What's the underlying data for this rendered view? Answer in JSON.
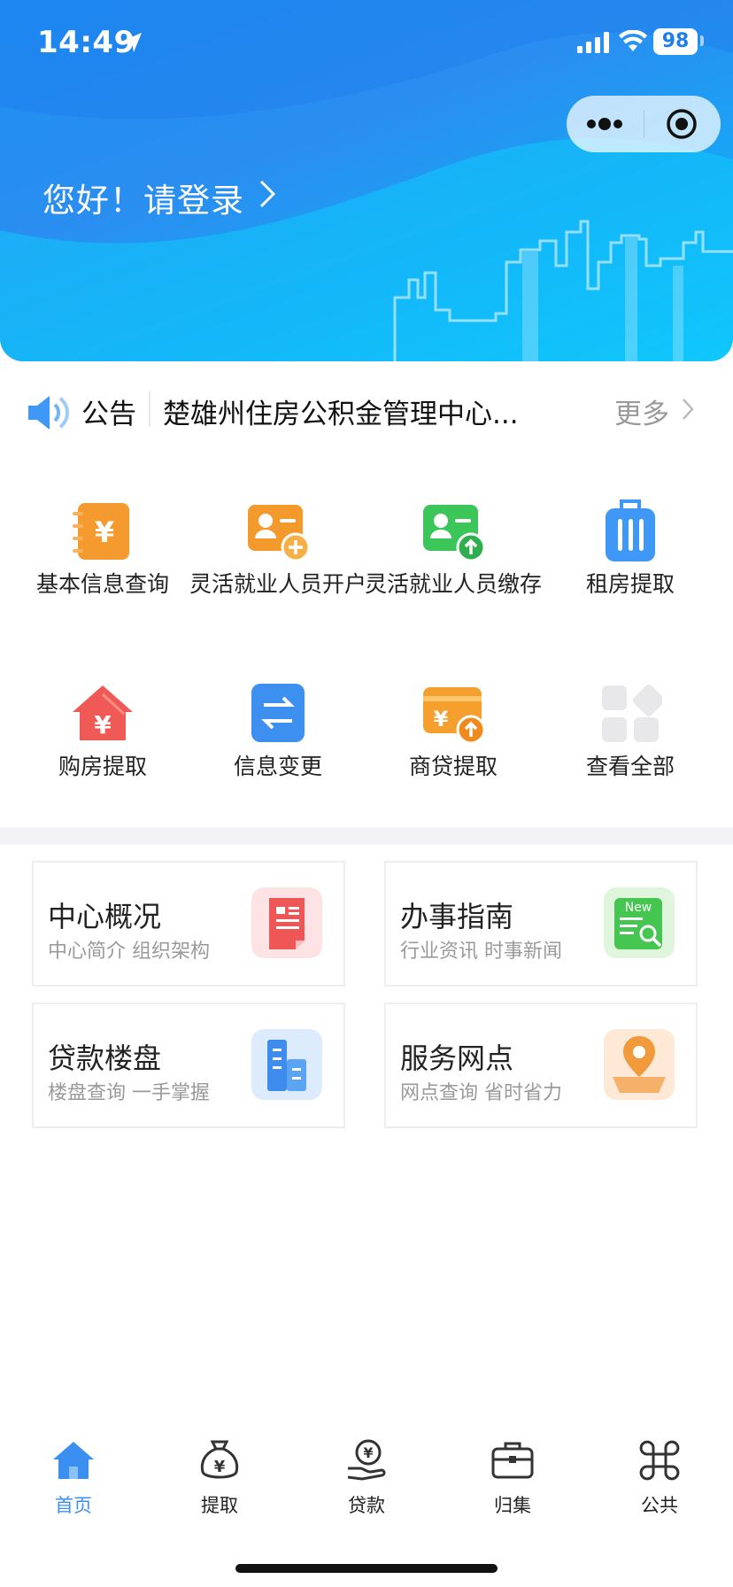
{
  "status": {
    "time": "14:49",
    "battery": "98"
  },
  "header": {
    "greeting": "您好！请登录"
  },
  "notice": {
    "label": "公告",
    "text": "楚雄州住房公积金管理中心...",
    "more": "更多"
  },
  "grid": [
    {
      "label": "基本信息查询",
      "icon": "notebook-yen-icon"
    },
    {
      "label": "灵活就业人员开户",
      "icon": "user-add-card-icon"
    },
    {
      "label": "灵活就业人员缴存",
      "icon": "user-upload-card-icon"
    },
    {
      "label": "租房提取",
      "icon": "luggage-icon"
    },
    {
      "label": "购房提取",
      "icon": "house-yen-icon"
    },
    {
      "label": "信息变更",
      "icon": "swap-arrows-icon"
    },
    {
      "label": "商贷提取",
      "icon": "card-yen-upload-icon"
    },
    {
      "label": "查看全部",
      "icon": "all-apps-icon"
    }
  ],
  "cards": [
    {
      "title": "中心概况",
      "subtitle": "中心简介 组织架构",
      "icon": "document-icon"
    },
    {
      "title": "办事指南",
      "subtitle": "行业资讯 时事新闻",
      "icon": "news-icon",
      "badge": "New"
    },
    {
      "title": "贷款楼盘",
      "subtitle": "楼盘查询 一手掌握",
      "icon": "building-icon"
    },
    {
      "title": "服务网点",
      "subtitle": "网点查询 省时省力",
      "icon": "map-pin-icon"
    }
  ],
  "tabs": [
    {
      "label": "首页",
      "icon": "home-icon",
      "active": true
    },
    {
      "label": "提取",
      "icon": "money-bag-icon"
    },
    {
      "label": "贷款",
      "icon": "coin-hand-icon"
    },
    {
      "label": "归集",
      "icon": "briefcase-icon"
    },
    {
      "label": "公共",
      "icon": "command-icon"
    }
  ],
  "colors": {
    "primary": "#2b8ef0",
    "active_tab": "#3a8ff0"
  }
}
